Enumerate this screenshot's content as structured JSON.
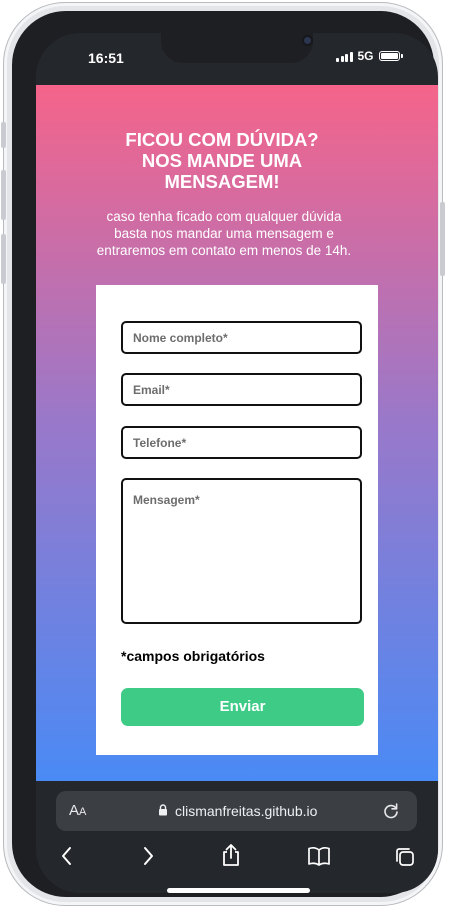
{
  "status_bar": {
    "time": "16:51",
    "network": "5G"
  },
  "page": {
    "heading": "FICOU COM DÚVIDA? NOS MANDE UMA MENSAGEM!",
    "subtitle": "caso tenha ficado com qualquer dúvida basta nos mandar uma mensagem e entraremos em contato em menos de 14h.",
    "colors": {
      "gradient_top": "#f5648a",
      "gradient_mid": "#9a78c9",
      "gradient_bottom": "#4a8af5",
      "submit_button": "#3dcb86"
    }
  },
  "form": {
    "name_placeholder": "Nome completo*",
    "email_placeholder": "Email*",
    "phone_placeholder": "Telefone*",
    "message_placeholder": "Mensagem*",
    "required_note": "*campos obrigatórios",
    "submit_label": "Enviar"
  },
  "browser": {
    "text_size_label": "AA",
    "url": "clismanfreitas.github.io",
    "icons": [
      "text-size-icon",
      "lock-icon",
      "reload-icon",
      "back-icon",
      "forward-icon",
      "share-icon",
      "bookmarks-icon",
      "tabs-icon"
    ]
  }
}
